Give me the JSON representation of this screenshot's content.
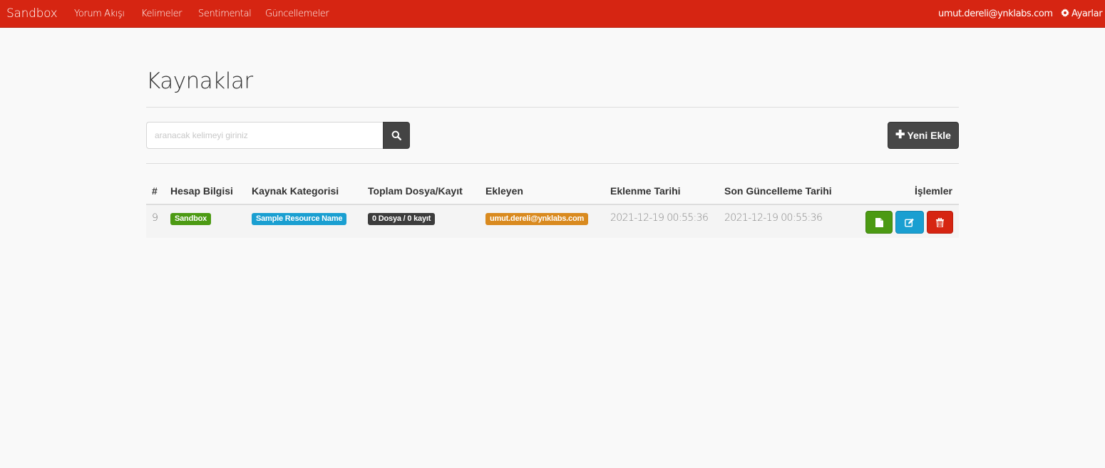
{
  "navbar": {
    "brand": "Sandbox",
    "links": [
      "Yorum Akışı",
      "Kelimeler",
      "Sentimental",
      "Güncellemeler"
    ],
    "user_email": "umut.dereli@ynklabs.com",
    "settings_label": "Ayarlar"
  },
  "page": {
    "title": "Kaynaklar"
  },
  "search": {
    "placeholder": "aranacak kelimeyi giriniz",
    "value": ""
  },
  "toolbar": {
    "add_label": "Yeni Ekle"
  },
  "table": {
    "headers": [
      "#",
      "Hesap Bilgisi",
      "Kaynak Kategorisi",
      "Toplam Dosya/Kayıt",
      "Ekleyen",
      "Eklenme Tarihi",
      "Son Güncelleme Tarihi",
      "İşlemler"
    ],
    "rows": [
      {
        "id": "9",
        "account": "Sandbox",
        "category": "Sample Resource Name",
        "totals": "0 Dosya / 0 kayıt",
        "added_by": "umut.dereli@ynklabs.com",
        "created_at": "2021-12-19 00:55:36",
        "updated_at": "2021-12-19 00:55:36"
      }
    ]
  },
  "colors": {
    "navbar": "#d62512",
    "badge_account": "#4c9a13",
    "badge_category": "#1a9fd1",
    "badge_totals": "#3c3c3c",
    "badge_added_by": "#d98a1f",
    "btn_view": "#4c9a13",
    "btn_edit": "#1a9fd1",
    "btn_delete": "#d62512"
  },
  "icons": {
    "brand_settings": "gear-icon",
    "search": "search-icon",
    "add": "plus-icon",
    "view": "file-icon",
    "edit": "edit-icon",
    "delete": "trash-icon"
  }
}
